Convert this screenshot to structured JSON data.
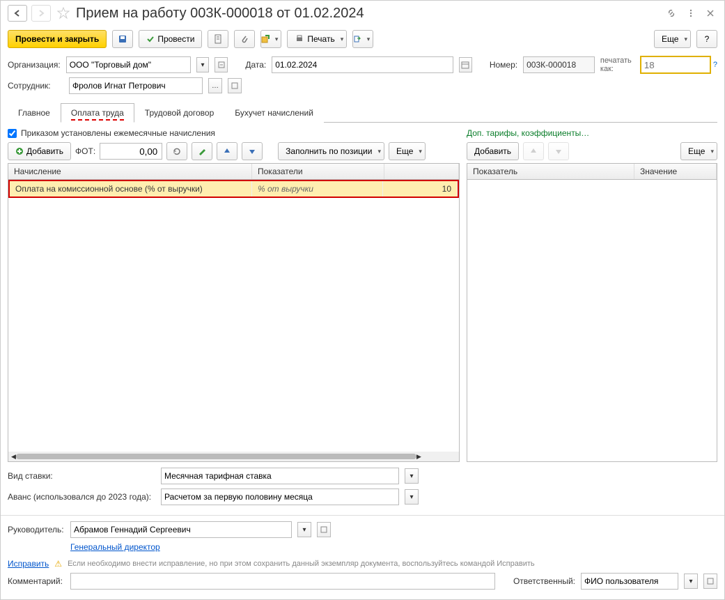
{
  "title": "Прием на работу 003К-000018 от 01.02.2024",
  "toolbar": {
    "process_close": "Провести и закрыть",
    "process": "Провести",
    "print": "Печать",
    "more1": "Еще",
    "help": "?"
  },
  "org": {
    "label": "Организация:",
    "value": "ООО \"Торговый дом\""
  },
  "date": {
    "label": "Дата:",
    "value": "01.02.2024"
  },
  "number": {
    "label": "Номер:",
    "value": "003К-000018"
  },
  "print_as": {
    "label": "печатать как:",
    "placeholder": "18",
    "help": "?"
  },
  "employee": {
    "label": "Сотрудник:",
    "value": "Фролов Игнат Петрович"
  },
  "tabs": [
    "Главное",
    "Оплата труда",
    "Трудовой договор",
    "Бухучет начислений"
  ],
  "chk_monthly": "Приказом установлены ежемесячные начисления",
  "add_btn": "Добавить",
  "fot_label": "ФОТ:",
  "fot_value": "0,00",
  "fill_by_pos": "Заполнить по позиции",
  "more2": "Еще",
  "extra_tariffs": "Доп. тарифы, коэффициенты…",
  "add_btn2": "Добавить",
  "more3": "Еще",
  "left_grid": {
    "cols": [
      "Начисление",
      "Показатели",
      ""
    ],
    "row": {
      "name": "Оплата на комиссионной основе (% от выручки)",
      "indicator": "% от выручки",
      "value": "10"
    }
  },
  "right_grid": {
    "cols": [
      "Показатель",
      "Значение"
    ]
  },
  "rate_type": {
    "label": "Вид ставки:",
    "value": "Месячная тарифная ставка"
  },
  "advance": {
    "label": "Аванс (использовался до 2023 года):",
    "value": "Расчетом за первую половину месяца"
  },
  "manager": {
    "label": "Руководитель:",
    "value": "Абрамов Геннадий Сергеевич",
    "position": "Генеральный директор"
  },
  "fix_link": "Исправить",
  "fix_msg": "Если необходимо внести исправление, но при этом сохранить данный экземпляр документа, воспользуйтесь командой Исправить",
  "comment": {
    "label": "Комментарий:",
    "value": ""
  },
  "responsible": {
    "label": "Ответственный:",
    "value": "ФИО пользователя"
  }
}
